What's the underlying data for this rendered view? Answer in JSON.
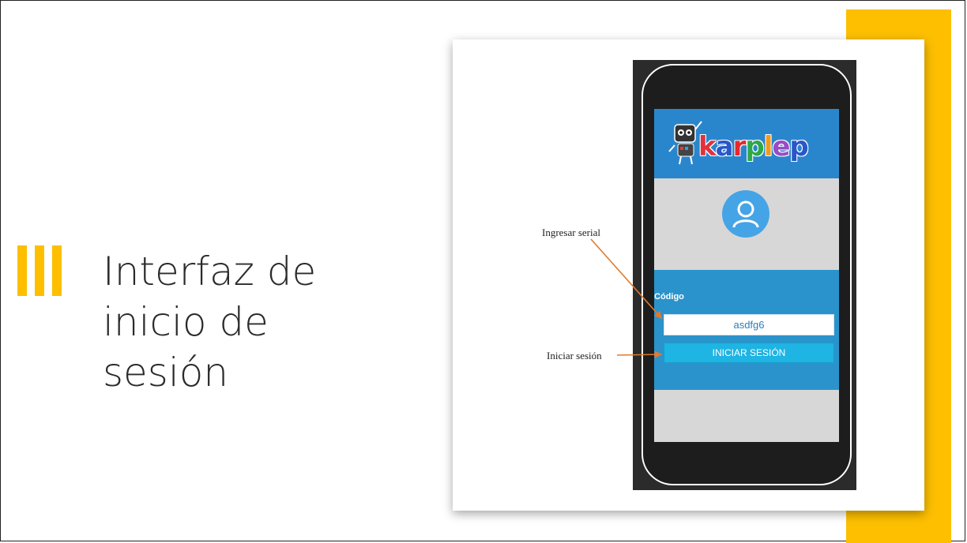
{
  "slide": {
    "title_lines": [
      "Interfaz de",
      "inicio de",
      "sesión"
    ]
  },
  "app": {
    "logo_text": "karplep",
    "logo_letters": [
      {
        "char": "k",
        "color": "#e0323c"
      },
      {
        "char": "a",
        "color": "#2a56c8"
      },
      {
        "char": "r",
        "color": "#e8272a"
      },
      {
        "char": "p",
        "color": "#2ea84a"
      },
      {
        "char": "l",
        "color": "#f29a1c"
      },
      {
        "char": "e",
        "color": "#9a4bc4"
      },
      {
        "char": "p",
        "color": "#2a56c8"
      }
    ],
    "code_label": "Código",
    "serial_value": "asdfg6",
    "login_button_label": "INICIAR SESIÓN"
  },
  "annotations": {
    "serial_callout": "Ingresar serial",
    "login_callout": "Iniciar sesión"
  },
  "colors": {
    "accent": "#FDBF00",
    "header_blue": "#2a86cc",
    "panel_blue": "#2b93cb",
    "button_cyan": "#1eb4e4",
    "arrow": "#e07a2e"
  },
  "icons": {
    "avatar": "user-avatar-icon",
    "mascot": "robot-mascot-icon"
  }
}
